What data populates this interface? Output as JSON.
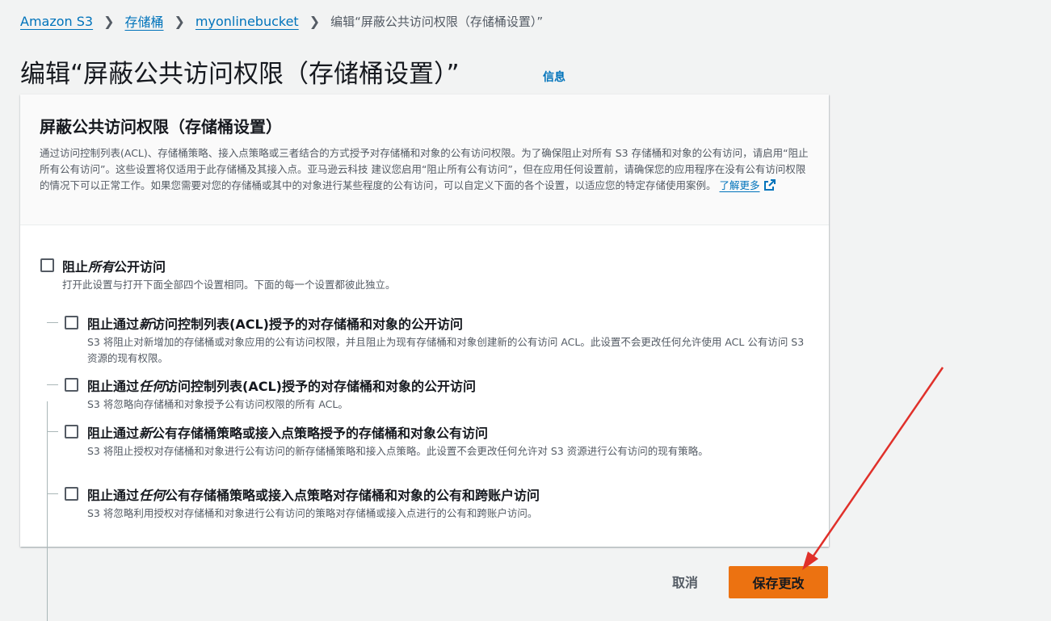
{
  "breadcrumb": {
    "items": [
      "Amazon S3",
      "存储桶",
      "myonlinebucket"
    ],
    "current": "编辑“屏蔽公共访问权限（存储桶设置）”"
  },
  "page": {
    "title": "编辑“屏蔽公共访问权限（存储桶设置）”",
    "info_link": "信息"
  },
  "panel": {
    "title": "屏蔽公共访问权限（存储桶设置）",
    "description": "通过访问控制列表(ACL)、存储桶策略、接入点策略或三者结合的方式授予对存储桶和对象的公有访问权限。为了确保阻止对所有 S3 存储桶和对象的公有访问，请启用“阻止所有公有访问”。这些设置将仅适用于此存储桶及其接入点。亚马逊云科技 建议您启用“阻止所有公有访问”，但在应用任何设置前，请确保您的应用程序在没有公有访问权限的情况下可以正常工作。如果您需要对您的存储桶或其中的对象进行某些程度的公有访问，可以自定义下面的各个设置，以适应您的特定存储使用案例。",
    "learn_more": "了解更多"
  },
  "options": {
    "block_all": {
      "label_prefix": "阻止",
      "label_emph": "所有",
      "label_suffix": "公开访问",
      "checked": false,
      "desc": "打开此设置与打开下面全部四个设置相同。下面的每一个设置都彼此独立。"
    },
    "items": [
      {
        "label_prefix": "阻止通过",
        "label_emph": "新",
        "label_suffix": "访问控制列表(ACL)授予的对存储桶和对象的公开访问",
        "checked": false,
        "desc": "S3 将阻止对新增加的存储桶或对象应用的公有访问权限，并且阻止为现有存储桶和对象创建新的公有访问 ACL。此设置不会更改任何允许使用 ACL 公有访问 S3 资源的现有权限。"
      },
      {
        "label_prefix": "阻止通过",
        "label_emph": "任何",
        "label_suffix": "访问控制列表(ACL)授予的对存储桶和对象的公开访问",
        "checked": false,
        "desc": "S3 将忽略向存储桶和对象授予公有访问权限的所有 ACL。"
      },
      {
        "label_prefix": "阻止通过",
        "label_emph": "新",
        "label_suffix": "公有存储桶策略或接入点策略授予的存储桶和对象公有访问",
        "checked": false,
        "desc": "S3 将阻止授权对存储桶和对象进行公有访问的新存储桶策略和接入点策略。此设置不会更改任何允许对 S3 资源进行公有访问的现有策略。"
      },
      {
        "label_prefix": "阻止通过",
        "label_emph": "任何",
        "label_suffix": "公有存储桶策略或接入点策略对存储桶和对象的公有和跨账户访问",
        "checked": false,
        "desc": "S3 将忽略利用授权对存储桶和对象进行公有访问的策略对存储桶或接入点进行的公有和跨账户访问。"
      }
    ]
  },
  "footer": {
    "cancel_label": "取消",
    "save_label": "保存更改"
  },
  "colors": {
    "link": "#0073bb",
    "primary_button": "#ec7211",
    "annotation_arrow": "#e0302a"
  }
}
